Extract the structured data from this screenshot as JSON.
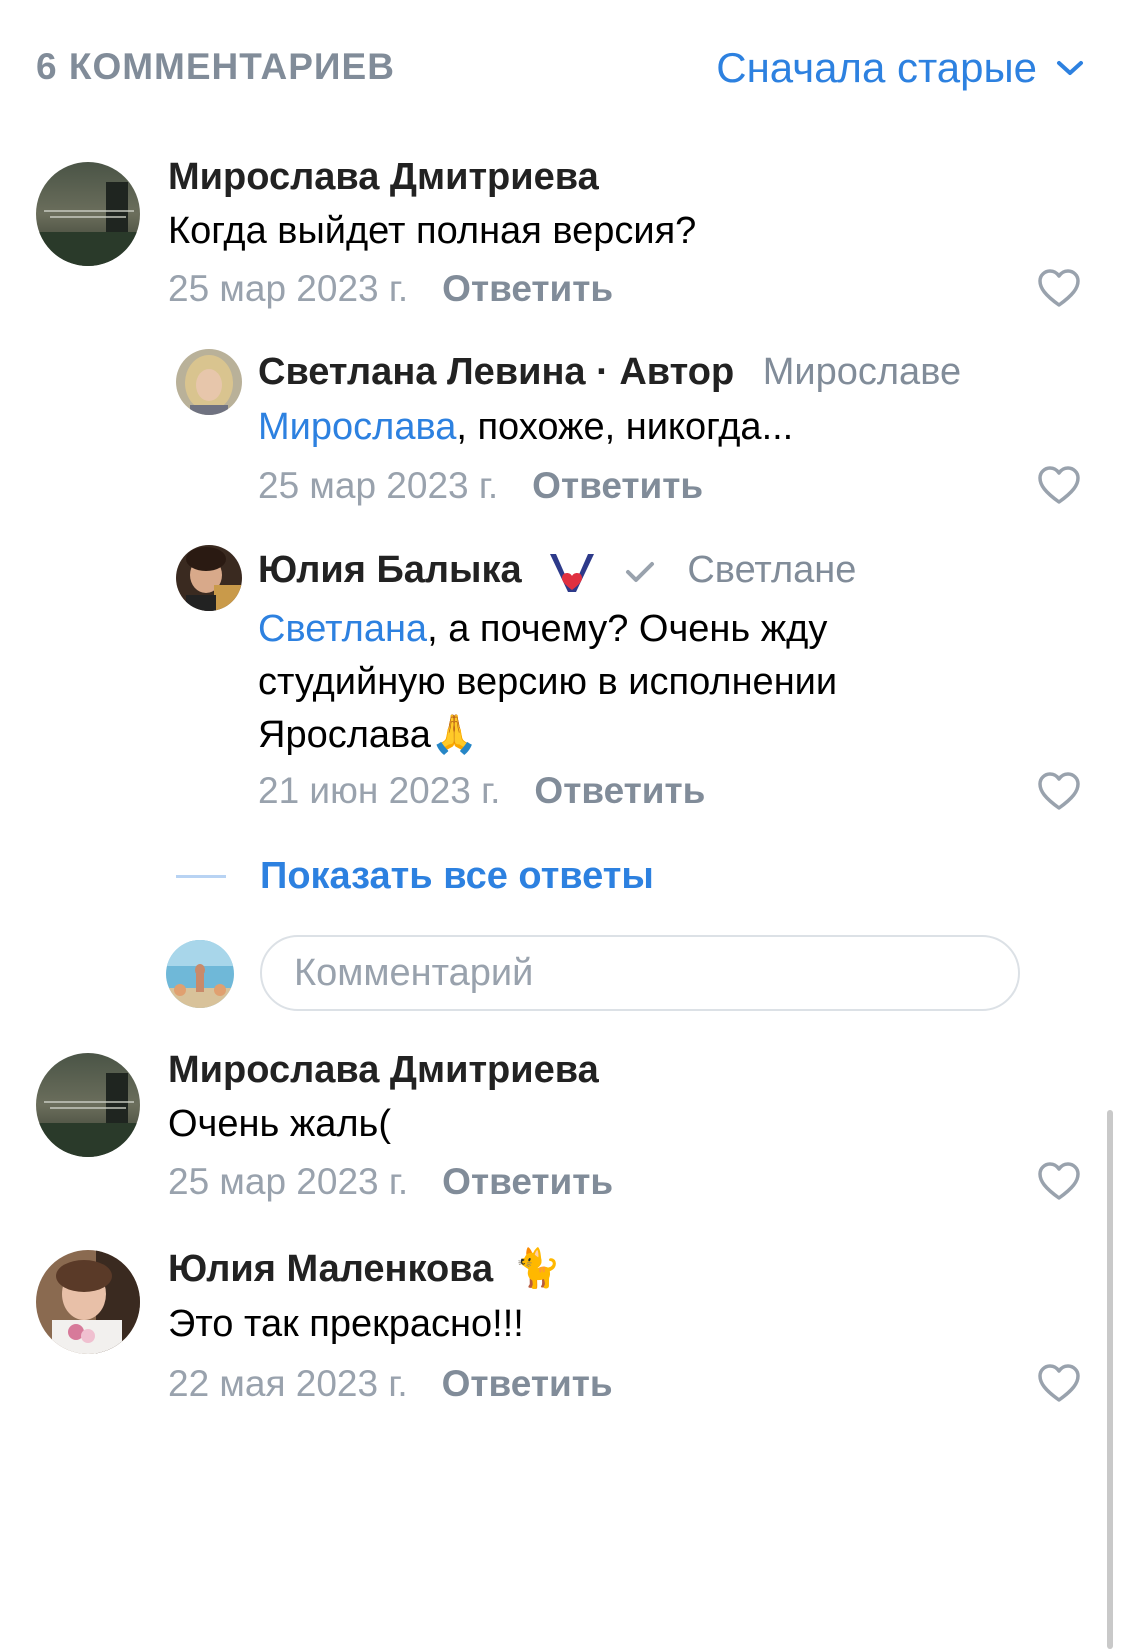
{
  "header": {
    "count_label": "6 КОММЕНТАРИЕВ",
    "sort_label": "Сначала старые",
    "sort_icon": "chevron-down-icon"
  },
  "comments": [
    {
      "author": "Мирослава Дмитриева",
      "text": "Когда выйдет полная версия?",
      "date": "25 мар 2023 г.",
      "reply_label": "Ответить"
    },
    {
      "author": "Светлана Левина · Автор",
      "reply_to": "Мирославе",
      "mention": "Мирослава",
      "text": ", похоже, никогда...",
      "date": "25 мар 2023 г.",
      "reply_label": "Ответить"
    },
    {
      "author": "Юлия Балыка",
      "badge": "heart-badge-icon",
      "reply_to": "Светлане",
      "mention": "Светлана",
      "text": ", а почему? Очень жду студийную версию в исполнении Ярослава🙏",
      "date": "21 июн 2023 г.",
      "reply_label": "Ответить"
    },
    {
      "author": "Мирослава Дмитриева",
      "text": "Очень жаль(",
      "date": "25 мар 2023 г.",
      "reply_label": "Ответить"
    },
    {
      "author": "Юлия Маленкова",
      "author_emoji": "🐈",
      "text": "Это так прекрасно!!!",
      "date": "22 мая 2023 г.",
      "reply_label": "Ответить"
    }
  ],
  "show_all_replies": "Показать все ответы",
  "comment_input": {
    "placeholder": "Комментарий",
    "value": ""
  },
  "colors": {
    "accent": "#2d81e0",
    "secondary": "#818c99",
    "muted": "#99a2ad"
  }
}
